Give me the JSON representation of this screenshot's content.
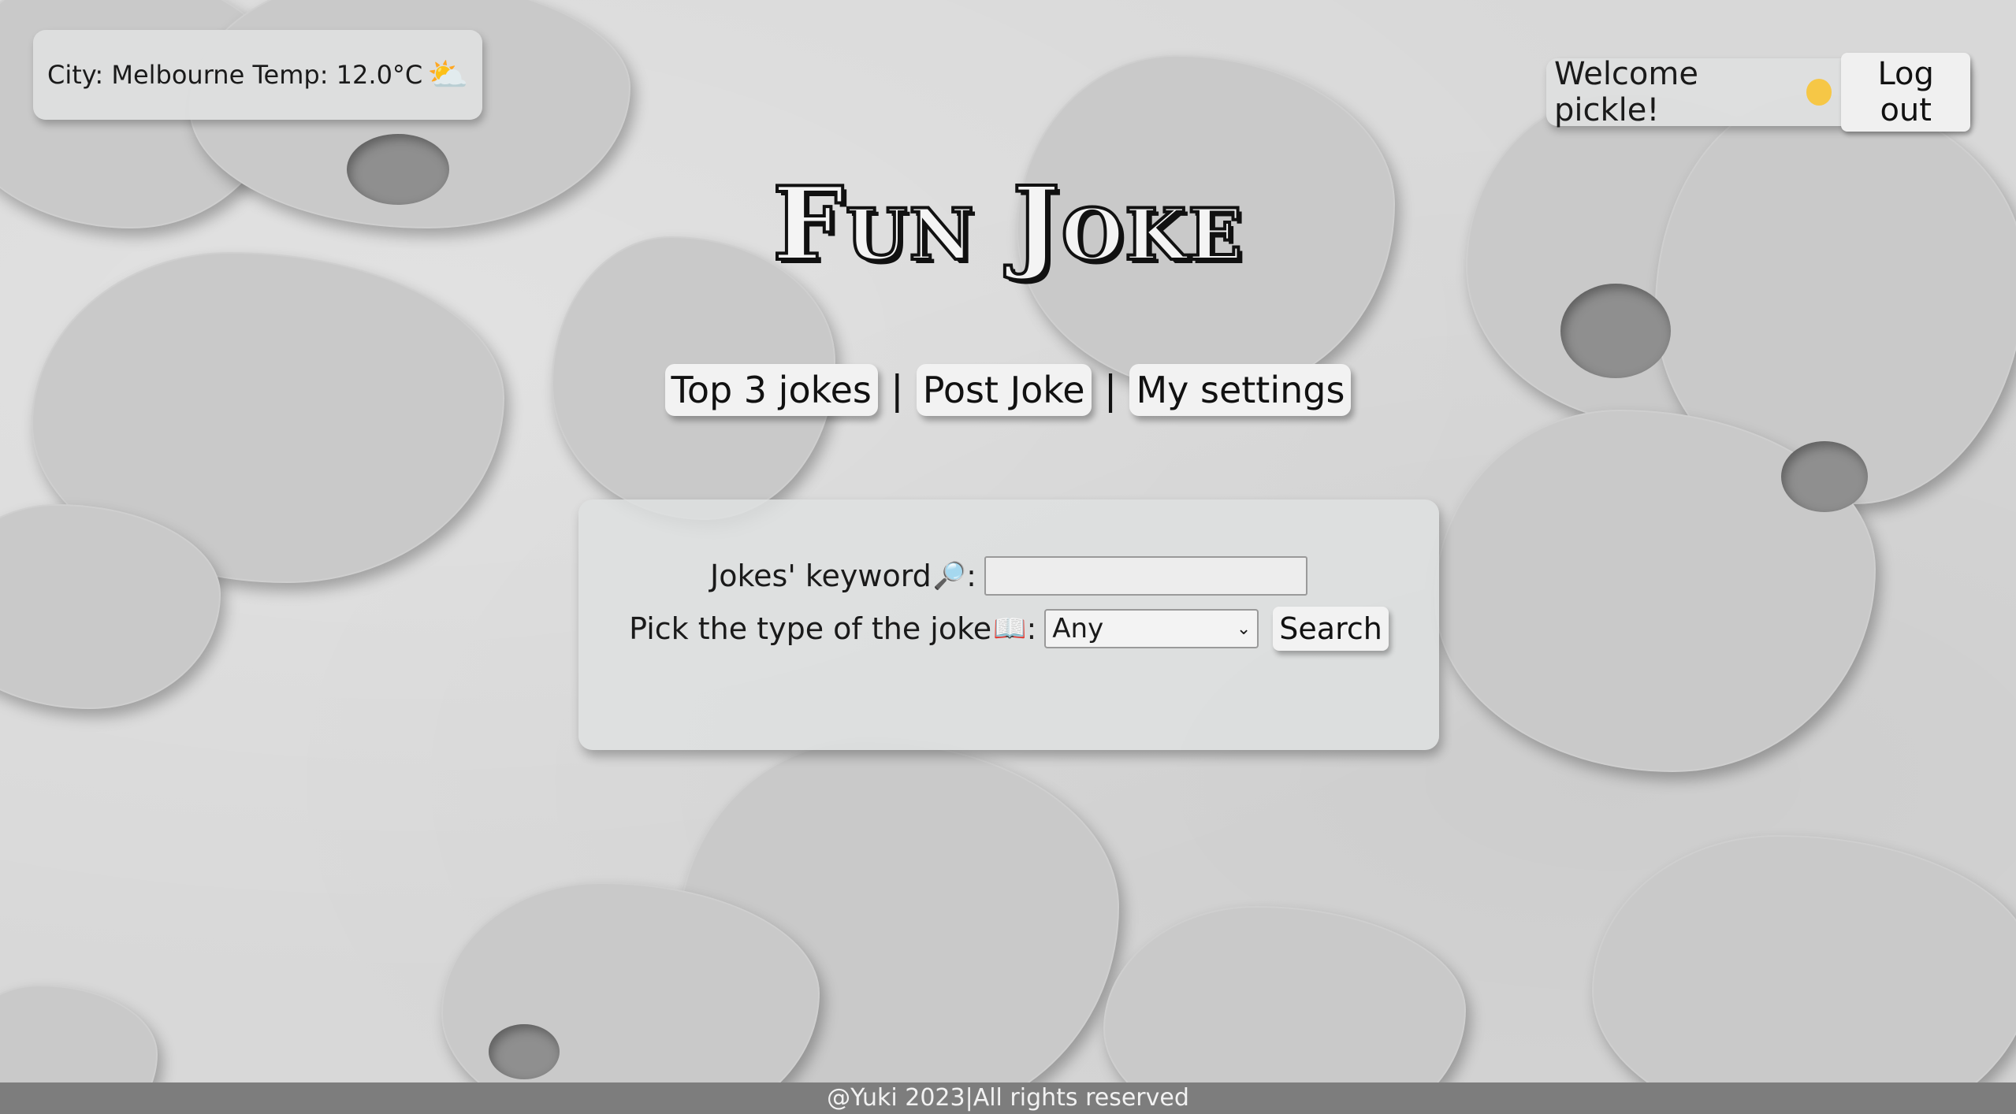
{
  "weather": {
    "text": "City: Melbourne Temp: 12.0°C",
    "icon": "partly-cloudy-icon"
  },
  "user": {
    "welcome": "Welcome pickle!",
    "logout_label": "Log out"
  },
  "title": "Fun Joke",
  "nav": {
    "items": [
      {
        "label": "Top 3 jokes"
      },
      {
        "label": "Post Joke"
      },
      {
        "label": "My settings"
      }
    ],
    "separator": "|"
  },
  "search": {
    "keyword_label": "Jokes' keyword",
    "keyword_value": "",
    "type_label": "Pick the type of the joke",
    "type_selected": "Any",
    "button_label": "Search",
    "colon": ":"
  },
  "footer": {
    "text": "@Yuki 2023|All rights reserved"
  }
}
